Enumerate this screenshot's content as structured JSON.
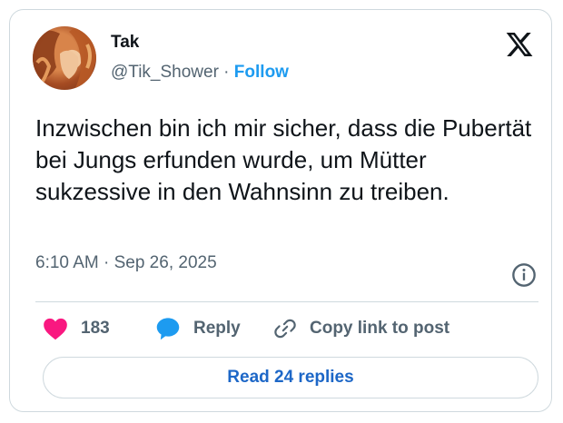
{
  "tweet": {
    "author_name": "Tak",
    "handle": "@Tik_Shower",
    "separator": " · ",
    "follow_label": "Follow",
    "text": "Inzwischen bin ich mir sicher, dass die Pubertät bei Jungs erfunden wurde, um Mütter sukzessive in den Wahnsinn zu treiben.",
    "timestamp": "6:10 AM · Sep 26, 2025"
  },
  "actions": {
    "like_count": "183",
    "reply_label": "Reply",
    "copy_label": "Copy link to post"
  },
  "read_replies_label": "Read 24 replies",
  "icons": {
    "brand": "x-logo-icon",
    "info": "info-icon",
    "like": "heart-icon",
    "reply": "speech-bubble-icon",
    "copy": "link-icon"
  },
  "colors": {
    "accent": "#1d9bf0",
    "like": "#f91880",
    "reply": "#1d9bf0",
    "text": "#0f1419",
    "muted": "#536471",
    "border": "#cfd9de"
  }
}
